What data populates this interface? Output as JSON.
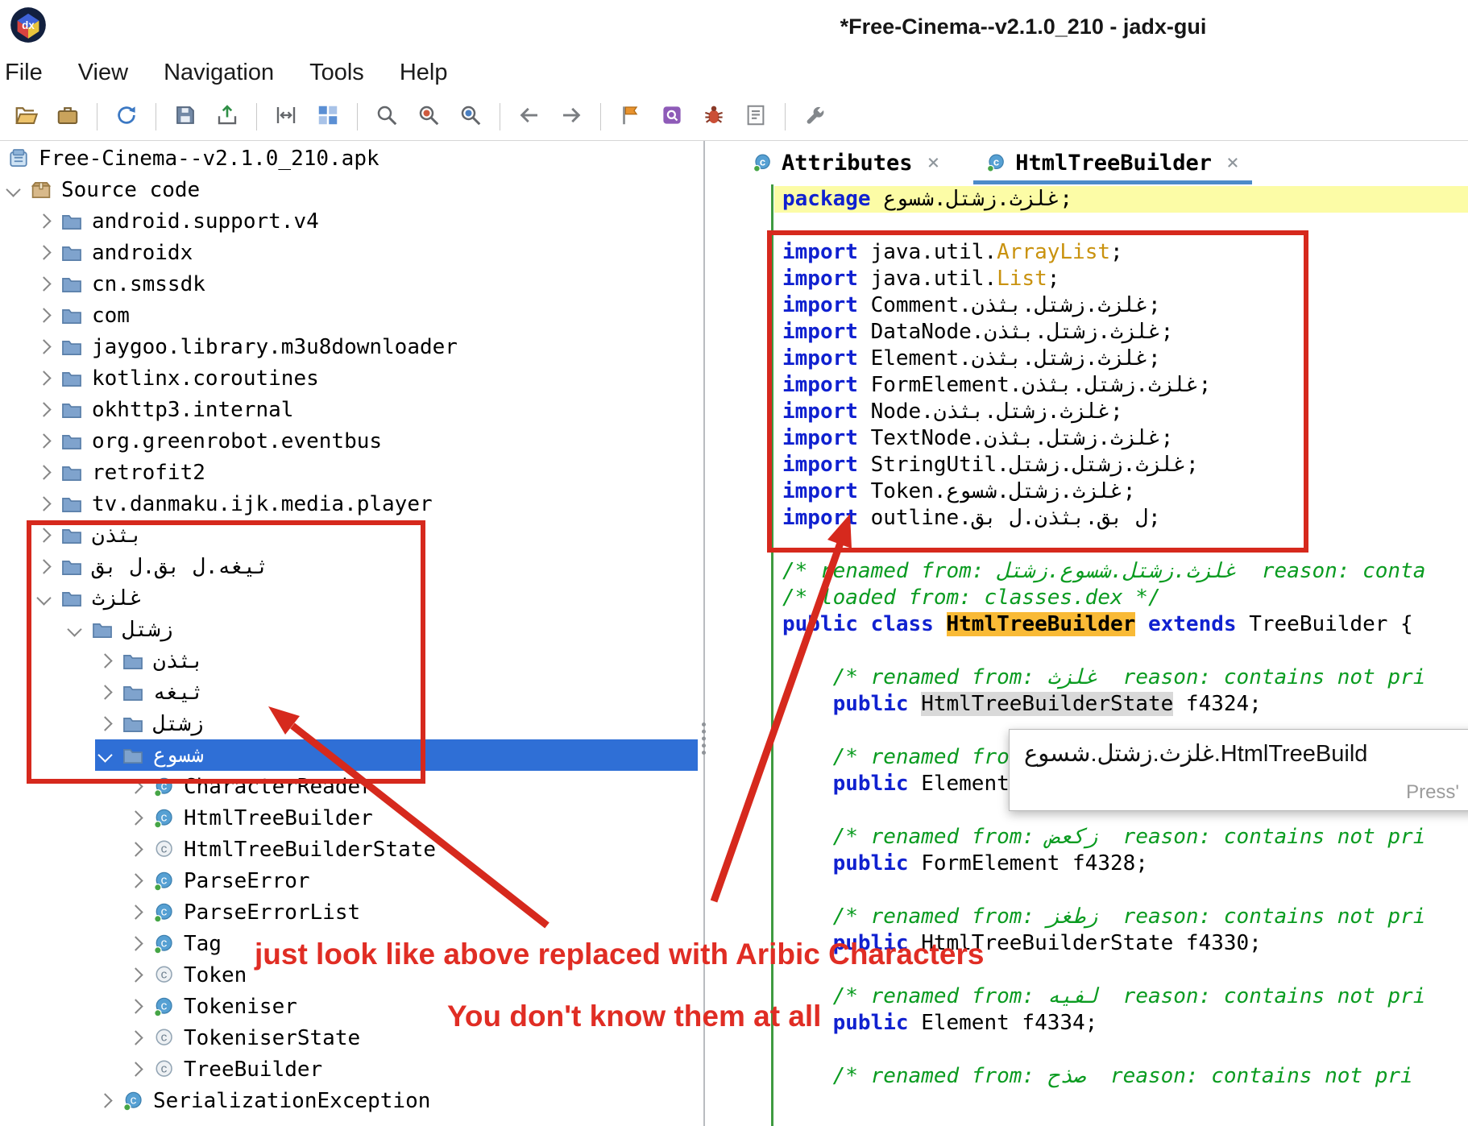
{
  "window": {
    "title": "*Free-Cinema--v2.1.0_210 - jadx-gui",
    "logo": "jadx-logo"
  },
  "menu": {
    "items": [
      "File",
      "View",
      "Navigation",
      "Tools",
      "Help"
    ]
  },
  "toolbar": {
    "items": [
      {
        "icon": "open-file"
      },
      {
        "icon": "open-project"
      },
      {
        "sep": true
      },
      {
        "icon": "reload"
      },
      {
        "sep": true
      },
      {
        "icon": "save-all"
      },
      {
        "icon": "export"
      },
      {
        "sep": true
      },
      {
        "icon": "flat-packages"
      },
      {
        "icon": "heap-usage"
      },
      {
        "sep": true
      },
      {
        "icon": "text-search"
      },
      {
        "icon": "class-search"
      },
      {
        "icon": "comment-search"
      },
      {
        "sep": true
      },
      {
        "icon": "back"
      },
      {
        "icon": "forward"
      },
      {
        "sep": true
      },
      {
        "icon": "deobfuscation"
      },
      {
        "icon": "quark"
      },
      {
        "icon": "debugger"
      },
      {
        "icon": "log"
      },
      {
        "sep": true
      },
      {
        "icon": "preferences"
      }
    ]
  },
  "tree": {
    "items": [
      {
        "depth": 0,
        "chevron": "none",
        "icon": "apk",
        "label": "Free-Cinema--v2.1.0_210.apk"
      },
      {
        "depth": 0,
        "chevron": "down",
        "icon": "package",
        "label": "Source code"
      },
      {
        "depth": 1,
        "chevron": "right",
        "icon": "folder",
        "label": "android.support.v4"
      },
      {
        "depth": 1,
        "chevron": "right",
        "icon": "folder",
        "label": "androidx"
      },
      {
        "depth": 1,
        "chevron": "right",
        "icon": "folder",
        "label": "cn.smssdk"
      },
      {
        "depth": 1,
        "chevron": "right",
        "icon": "folder",
        "label": "com"
      },
      {
        "depth": 1,
        "chevron": "right",
        "icon": "folder",
        "label": "jaygoo.library.m3u8downloader"
      },
      {
        "depth": 1,
        "chevron": "right",
        "icon": "folder",
        "label": "kotlinx.coroutines"
      },
      {
        "depth": 1,
        "chevron": "right",
        "icon": "folder",
        "label": "okhttp3.internal"
      },
      {
        "depth": 1,
        "chevron": "right",
        "icon": "folder",
        "label": "org.greenrobot.eventbus"
      },
      {
        "depth": 1,
        "chevron": "right",
        "icon": "folder",
        "label": "retrofit2"
      },
      {
        "depth": 1,
        "chevron": "right",
        "icon": "folder",
        "label": "tv.danmaku.ijk.media.player"
      },
      {
        "depth": 1,
        "chevron": "right",
        "icon": "folder",
        "label": "بثذن",
        "ar": true
      },
      {
        "depth": 1,
        "chevron": "right",
        "icon": "folder",
        "label": "ثيغه.ل بق.ل بق",
        "ar": true
      },
      {
        "depth": 1,
        "chevron": "down",
        "icon": "folder",
        "label": "غلزث",
        "ar": true
      },
      {
        "depth": 2,
        "chevron": "down",
        "icon": "folder",
        "label": "زشتل",
        "ar": true
      },
      {
        "depth": 3,
        "chevron": "right",
        "icon": "folder",
        "label": "بثذن",
        "ar": true
      },
      {
        "depth": 3,
        "chevron": "right",
        "icon": "folder",
        "label": "ثيغه",
        "ar": true
      },
      {
        "depth": 3,
        "chevron": "right",
        "icon": "folder",
        "label": "زشتل",
        "ar": true
      },
      {
        "depth": 3,
        "chevron": "down",
        "icon": "folder",
        "label": "شسوع",
        "ar": true,
        "selected": true
      },
      {
        "depth": 4,
        "chevron": "right",
        "icon": "class",
        "label": "CharacterReader"
      },
      {
        "depth": 4,
        "chevron": "right",
        "icon": "class",
        "label": "HtmlTreeBuilder"
      },
      {
        "depth": 4,
        "chevron": "right",
        "icon": "class-alt",
        "label": "HtmlTreeBuilderState"
      },
      {
        "depth": 4,
        "chevron": "right",
        "icon": "class",
        "label": "ParseError"
      },
      {
        "depth": 4,
        "chevron": "right",
        "icon": "class",
        "label": "ParseErrorList"
      },
      {
        "depth": 4,
        "chevron": "right",
        "icon": "class",
        "label": "Tag"
      },
      {
        "depth": 4,
        "chevron": "right",
        "icon": "class-alt",
        "label": "Token"
      },
      {
        "depth": 4,
        "chevron": "right",
        "icon": "class",
        "label": "Tokeniser"
      },
      {
        "depth": 4,
        "chevron": "right",
        "icon": "class-alt",
        "label": "TokeniserState"
      },
      {
        "depth": 4,
        "chevron": "right",
        "icon": "class-alt",
        "label": "TreeBuilder"
      },
      {
        "depth": 3,
        "chevron": "right",
        "icon": "class",
        "label": "SerializationException"
      }
    ]
  },
  "editor": {
    "tabs": [
      {
        "label": "Attributes",
        "active": false
      },
      {
        "label": "HtmlTreeBuilder",
        "active": true
      }
    ]
  },
  "code": {
    "lines": [
      {
        "hl": true,
        "segs": [
          {
            "t": "package ",
            "c": "kw"
          },
          {
            "t": "شسوع",
            "c": "pl",
            "ar": true
          },
          {
            "t": ".",
            "c": "pl"
          },
          {
            "t": "زشتل",
            "c": "pl",
            "ar": true
          },
          {
            "t": ".",
            "c": "pl"
          },
          {
            "t": "غلزث",
            "c": "pl",
            "ar": true
          },
          {
            "t": ";",
            "c": "pl"
          }
        ]
      },
      {
        "segs": []
      },
      {
        "segs": [
          {
            "t": "import ",
            "c": "kw"
          },
          {
            "t": "java.util.",
            "c": "pl"
          },
          {
            "t": "ArrayList",
            "c": "cls"
          },
          {
            "t": ";",
            "c": "pl"
          }
        ]
      },
      {
        "segs": [
          {
            "t": "import ",
            "c": "kw"
          },
          {
            "t": "java.util.",
            "c": "pl"
          },
          {
            "t": "List",
            "c": "cls"
          },
          {
            "t": ";",
            "c": "pl"
          }
        ]
      },
      {
        "segs": [
          {
            "t": "import ",
            "c": "kw"
          },
          {
            "t": "Comment.",
            "c": "pl"
          },
          {
            "t": "بثذن",
            "c": "pl",
            "ar": true
          },
          {
            "t": ".",
            "c": "pl"
          },
          {
            "t": "زشتل",
            "c": "pl",
            "ar": true
          },
          {
            "t": ".",
            "c": "pl"
          },
          {
            "t": "غلزث",
            "c": "pl",
            "ar": true
          },
          {
            "t": ";",
            "c": "pl"
          }
        ]
      },
      {
        "segs": [
          {
            "t": "import ",
            "c": "kw"
          },
          {
            "t": "DataNode.",
            "c": "pl"
          },
          {
            "t": "بثذن",
            "c": "pl",
            "ar": true
          },
          {
            "t": ".",
            "c": "pl"
          },
          {
            "t": "زشتل",
            "c": "pl",
            "ar": true
          },
          {
            "t": ".",
            "c": "pl"
          },
          {
            "t": "غلزث",
            "c": "pl",
            "ar": true
          },
          {
            "t": ";",
            "c": "pl"
          }
        ]
      },
      {
        "segs": [
          {
            "t": "import ",
            "c": "kw"
          },
          {
            "t": "Element.",
            "c": "pl"
          },
          {
            "t": "بثذن",
            "c": "pl",
            "ar": true
          },
          {
            "t": ".",
            "c": "pl"
          },
          {
            "t": "زشتل",
            "c": "pl",
            "ar": true
          },
          {
            "t": ".",
            "c": "pl"
          },
          {
            "t": "غلزث",
            "c": "pl",
            "ar": true
          },
          {
            "t": ";",
            "c": "pl"
          }
        ]
      },
      {
        "segs": [
          {
            "t": "import ",
            "c": "kw"
          },
          {
            "t": "FormElement.",
            "c": "pl"
          },
          {
            "t": "بثذن",
            "c": "pl",
            "ar": true
          },
          {
            "t": ".",
            "c": "pl"
          },
          {
            "t": "زشتل",
            "c": "pl",
            "ar": true
          },
          {
            "t": ".",
            "c": "pl"
          },
          {
            "t": "غلزث",
            "c": "pl",
            "ar": true
          },
          {
            "t": ";",
            "c": "pl"
          }
        ]
      },
      {
        "segs": [
          {
            "t": "import ",
            "c": "kw"
          },
          {
            "t": "Node.",
            "c": "pl"
          },
          {
            "t": "بثذن",
            "c": "pl",
            "ar": true
          },
          {
            "t": ".",
            "c": "pl"
          },
          {
            "t": "زشتل",
            "c": "pl",
            "ar": true
          },
          {
            "t": ".",
            "c": "pl"
          },
          {
            "t": "غلزث",
            "c": "pl",
            "ar": true
          },
          {
            "t": ";",
            "c": "pl"
          }
        ]
      },
      {
        "segs": [
          {
            "t": "import ",
            "c": "kw"
          },
          {
            "t": "TextNode.",
            "c": "pl"
          },
          {
            "t": "بثذن",
            "c": "pl",
            "ar": true
          },
          {
            "t": ".",
            "c": "pl"
          },
          {
            "t": "زشتل",
            "c": "pl",
            "ar": true
          },
          {
            "t": ".",
            "c": "pl"
          },
          {
            "t": "غلزث",
            "c": "pl",
            "ar": true
          },
          {
            "t": ";",
            "c": "pl"
          }
        ]
      },
      {
        "segs": [
          {
            "t": "import ",
            "c": "kw"
          },
          {
            "t": "StringUtil.",
            "c": "pl"
          },
          {
            "t": "زشتل",
            "c": "pl",
            "ar": true
          },
          {
            "t": ".",
            "c": "pl"
          },
          {
            "t": "زشتل",
            "c": "pl",
            "ar": true
          },
          {
            "t": ".",
            "c": "pl"
          },
          {
            "t": "غلزث",
            "c": "pl",
            "ar": true
          },
          {
            "t": ";",
            "c": "pl"
          }
        ]
      },
      {
        "segs": [
          {
            "t": "import ",
            "c": "kw"
          },
          {
            "t": "Token.",
            "c": "pl"
          },
          {
            "t": "شسوع",
            "c": "pl",
            "ar": true
          },
          {
            "t": ".",
            "c": "pl"
          },
          {
            "t": "زشتل",
            "c": "pl",
            "ar": true
          },
          {
            "t": ".",
            "c": "pl"
          },
          {
            "t": "غلزث",
            "c": "pl",
            "ar": true
          },
          {
            "t": ";",
            "c": "pl"
          }
        ]
      },
      {
        "segs": [
          {
            "t": "import ",
            "c": "kw"
          },
          {
            "t": "outline.",
            "c": "pl"
          },
          {
            "t": "ل بق",
            "c": "pl",
            "ar": true
          },
          {
            "t": ".",
            "c": "pl"
          },
          {
            "t": "بثذن",
            "c": "pl",
            "ar": true
          },
          {
            "t": ".",
            "c": "pl"
          },
          {
            "t": "ل بق",
            "c": "pl",
            "ar": true
          },
          {
            "t": ";",
            "c": "pl"
          }
        ]
      },
      {
        "segs": []
      },
      {
        "segs": [
          {
            "t": "/* renamed from: ",
            "c": "cm"
          },
          {
            "t": "زشتل",
            "c": "cm",
            "ar": true
          },
          {
            "t": ".",
            "c": "cm"
          },
          {
            "t": "شسوع",
            "c": "cm",
            "ar": true
          },
          {
            "t": ".",
            "c": "cm"
          },
          {
            "t": "زشتل",
            "c": "cm",
            "ar": true
          },
          {
            "t": ".",
            "c": "cm"
          },
          {
            "t": "غلزث",
            "c": "cm",
            "ar": true
          },
          {
            "t": "  reason: conta",
            "c": "cm"
          }
        ]
      },
      {
        "segs": [
          {
            "t": "/* loaded from: classes.dex */",
            "c": "cm"
          }
        ]
      },
      {
        "segs": [
          {
            "t": "public class ",
            "c": "kw"
          },
          {
            "t": "HtmlTreeBuilder",
            "c": "hlA"
          },
          {
            "t": " ",
            "c": "pl"
          },
          {
            "t": "extends",
            "c": "kw"
          },
          {
            "t": " TreeBuilder {",
            "c": "pl"
          }
        ]
      },
      {
        "segs": []
      },
      {
        "segs": [
          {
            "t": "    /* renamed from: ",
            "c": "cm"
          },
          {
            "t": "غلزث",
            "c": "cm",
            "ar": true
          },
          {
            "t": "  reason: contains not pri",
            "c": "cm"
          }
        ]
      },
      {
        "segs": [
          {
            "t": "    public ",
            "c": "kw"
          },
          {
            "t": "HtmlTreeBuilderState",
            "c": "hlG"
          },
          {
            "t": " f4324;",
            "c": "pl"
          }
        ]
      },
      {
        "segs": []
      },
      {
        "segs": [
          {
            "t": "    /* renamed from: ",
            "c": "cm"
          }
        ]
      },
      {
        "segs": [
          {
            "t": "    public ",
            "c": "kw"
          },
          {
            "t": "Element ",
            "c": "pl"
          }
        ]
      },
      {
        "segs": []
      },
      {
        "segs": [
          {
            "t": "    /* renamed from: ",
            "c": "cm"
          },
          {
            "t": "زكعض",
            "c": "cm",
            "ar": true
          },
          {
            "t": "  reason: contains not pri",
            "c": "cm"
          }
        ]
      },
      {
        "segs": [
          {
            "t": "    public ",
            "c": "kw"
          },
          {
            "t": "FormElement f4328;",
            "c": "pl"
          }
        ]
      },
      {
        "segs": []
      },
      {
        "segs": [
          {
            "t": "    /* renamed from: ",
            "c": "cm"
          },
          {
            "t": "زطغز",
            "c": "cm",
            "ar": true
          },
          {
            "t": "  reason: contains not pri",
            "c": "cm"
          }
        ]
      },
      {
        "segs": [
          {
            "t": "    public ",
            "c": "kw"
          },
          {
            "t": "HtmlTreeBuilderState f4330;",
            "c": "pl"
          }
        ]
      },
      {
        "segs": []
      },
      {
        "segs": [
          {
            "t": "    /* renamed from: ",
            "c": "cm"
          },
          {
            "t": "لفيه",
            "c": "cm",
            "ar": true
          },
          {
            "t": "  reason: contains not pri",
            "c": "cm"
          }
        ]
      },
      {
        "segs": [
          {
            "t": "    public ",
            "c": "kw"
          },
          {
            "t": "Element f4334;",
            "c": "pl"
          }
        ]
      },
      {
        "segs": []
      },
      {
        "segs": [
          {
            "t": "    /* renamed from: ",
            "c": "cm"
          },
          {
            "t": "صذح",
            "c": "cm",
            "ar": true
          },
          {
            "t": "  reason: contains not pri",
            "c": "cm"
          }
        ]
      }
    ]
  },
  "tooltip": {
    "segs": [
      {
        "t": "شسوع",
        "ar": true
      },
      {
        "t": "."
      },
      {
        "t": "زشتل",
        "ar": true
      },
      {
        "t": "."
      },
      {
        "t": "غلزث",
        "ar": true
      },
      {
        "t": ".HtmlTreeBuild"
      }
    ],
    "hint": "Press'"
  },
  "annotations": {
    "note1": "just look like above replaced with Aribic Characters",
    "note2": "You don't know them at all"
  },
  "colors": {
    "selection": "#2f6fd6",
    "keyword": "#1021d0",
    "class_ref": "#c9920e",
    "comment": "#0a9b20",
    "line_highlight": "#fcfca6",
    "occurrence_highlight": "#f9ba36",
    "tab_underline": "#4c8bc9",
    "annotation_red": "#d6291d",
    "gutter_line_green": "#3f9b41"
  }
}
